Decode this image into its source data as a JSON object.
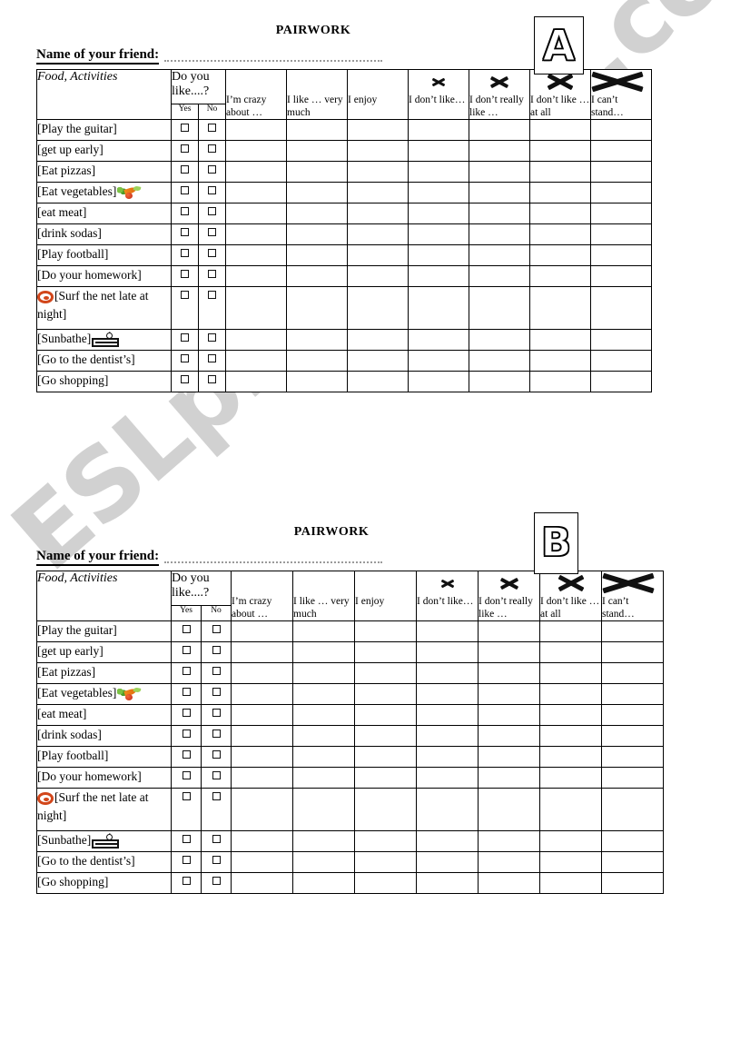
{
  "watermark": {
    "text": "ESLprintables.com"
  },
  "sections": [
    {
      "id": "a",
      "title": "PAIRWORK",
      "badge_letter": "A",
      "name_label": "Name of your friend:",
      "name_value": "",
      "table": {
        "label_header": "Food, Activities",
        "question_header": "Do you like....?",
        "yes_label": "Yes",
        "no_label": "No",
        "rating_columns": [
          {
            "icon": "heart-xl-icon",
            "text": "I’m crazy about …"
          },
          {
            "icon": "heart-lg-icon",
            "text": "I like … very much"
          },
          {
            "icon": "heart-md-icon",
            "text": "I enjoy"
          },
          {
            "icon": "x-small-icon",
            "text": "I don’t like…"
          },
          {
            "icon": "heart-crossed-small-icon",
            "text": "I don’t really like …"
          },
          {
            "icon": "heart-crossed-medium-icon",
            "text": "I don’t like … at all"
          },
          {
            "icon": "heart-crossed-large-icon",
            "text": "I can’t stand…"
          }
        ],
        "rows": [
          {
            "label": "[Play the guitar]",
            "icon": null,
            "tall": false
          },
          {
            "label": "[get up early]",
            "icon": null,
            "tall": false
          },
          {
            "label": "[Eat pizzas]",
            "icon": null,
            "tall": false
          },
          {
            "label": "[Eat vegetables]",
            "icon": "vegetables-icon",
            "tall": false
          },
          {
            "label": "[eat meat]",
            "icon": null,
            "tall": false
          },
          {
            "label": "[drink sodas]",
            "icon": null,
            "tall": false
          },
          {
            "label": "[Play football]",
            "icon": null,
            "tall": false
          },
          {
            "label": "[Do your homework]",
            "icon": null,
            "tall": false
          },
          {
            "label": "[Surf the net late at night]",
            "icon": "at-sign-icon",
            "tall": true
          },
          {
            "label": "[Sunbathe]",
            "icon": "sunbed-icon",
            "tall": false
          },
          {
            "label": "[Go to the dentist’s]",
            "icon": null,
            "tall": false
          },
          {
            "label": "[Go shopping]",
            "icon": null,
            "tall": false
          }
        ]
      }
    },
    {
      "id": "b",
      "title": "PAIRWORK",
      "badge_letter": "B",
      "name_label": "Name of your friend:",
      "name_value": "",
      "table": {
        "label_header": "Food, Activities",
        "question_header": "Do you like....?",
        "yes_label": "Yes",
        "no_label": "No",
        "rating_columns": [
          {
            "icon": "heart-xl-icon",
            "text": "I’m crazy about …"
          },
          {
            "icon": "heart-lg-icon",
            "text": "I like … very much"
          },
          {
            "icon": "heart-md-icon",
            "text": "I enjoy"
          },
          {
            "icon": "x-small-icon",
            "text": "I don’t like…"
          },
          {
            "icon": "heart-crossed-small-icon",
            "text": "I don’t really like …"
          },
          {
            "icon": "heart-crossed-medium-icon",
            "text": "I don’t like … at all"
          },
          {
            "icon": "heart-crossed-large-icon",
            "text": "I can’t stand…"
          }
        ],
        "rows": [
          {
            "label": "[Play the guitar]",
            "icon": null,
            "tall": false
          },
          {
            "label": "[get up early]",
            "icon": null,
            "tall": false
          },
          {
            "label": "[Eat pizzas]",
            "icon": null,
            "tall": false
          },
          {
            "label": "[Eat vegetables]",
            "icon": "vegetables-icon",
            "tall": false
          },
          {
            "label": "[eat meat]",
            "icon": null,
            "tall": false
          },
          {
            "label": "[drink sodas]",
            "icon": null,
            "tall": false
          },
          {
            "label": "[Play football]",
            "icon": null,
            "tall": false
          },
          {
            "label": "[Do your homework]",
            "icon": null,
            "tall": false
          },
          {
            "label": "[Surf the net late at night]",
            "icon": "at-sign-icon",
            "tall": true
          },
          {
            "label": "[Sunbathe]",
            "icon": "sunbed-icon",
            "tall": false
          },
          {
            "label": "[Go to the dentist’s]",
            "icon": null,
            "tall": false
          },
          {
            "label": "[Go shopping]",
            "icon": null,
            "tall": false
          }
        ]
      }
    }
  ]
}
